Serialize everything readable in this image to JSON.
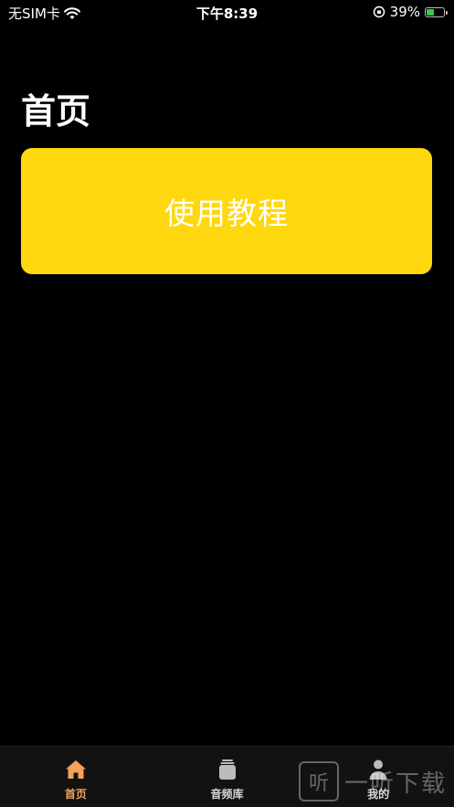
{
  "status_bar": {
    "carrier": "无SIM卡",
    "time": "下午8:39",
    "battery_percent": "39%",
    "battery_level": 0.39
  },
  "page": {
    "title": "首页",
    "tutorial_button": "使用教程",
    "accent_color": "#ffd70f"
  },
  "tab_bar": {
    "tabs": [
      {
        "label": "首页",
        "icon": "home-icon",
        "active": true
      },
      {
        "label": "音频库",
        "icon": "audio-library-icon",
        "active": false
      },
      {
        "label": "我的",
        "icon": "person-icon",
        "active": false
      }
    ],
    "active_color": "#f5a15a"
  },
  "watermark": {
    "logo_char": "听",
    "text": "一听下载"
  }
}
